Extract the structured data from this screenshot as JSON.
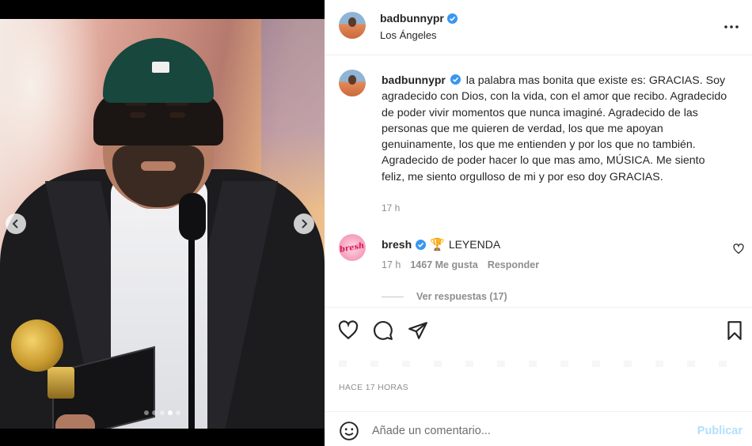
{
  "post": {
    "username": "badbunnypr",
    "location": "Los Ángeles",
    "caption": "la palabra mas bonita que existe es: GRACIAS. Soy agradecido con Dios, con la vida, con el amor que recibo. Agradecido de poder vivir momentos que nunca imaginé. Agradecido de las personas que me quieren de verdad, los que me apoyan genuinamente, los que me entienden y por los que no también. Agradecido de poder hacer lo que mas amo, MÚSICA. Me siento feliz, me siento orgulloso de mi y por eso doy GRACIAS.",
    "caption_time": "17 h",
    "time_ago": "HACE 17 HORAS"
  },
  "comment": {
    "username": "bresh",
    "avatar_text": "bresh",
    "emoji": "🏆",
    "text": "LEYENDA",
    "time": "17 h",
    "likes": "1467 Me gusta",
    "reply_label": "Responder",
    "view_replies": "Ver respuestas (17)"
  },
  "add_comment": {
    "placeholder": "Añade un comentario...",
    "post_label": "Publicar"
  },
  "media": {
    "slide_count": 5,
    "active_slide": 4
  },
  "colors": {
    "verified": "#3897f0",
    "muted": "#8e8e8e",
    "post_button": "#b2dffc",
    "text": "#262626"
  },
  "icons": [
    "verified-icon",
    "more-options-icon",
    "chevron-left-icon",
    "chevron-right-icon",
    "heart-icon",
    "comment-icon",
    "share-icon",
    "bookmark-icon",
    "emoji-icon"
  ]
}
